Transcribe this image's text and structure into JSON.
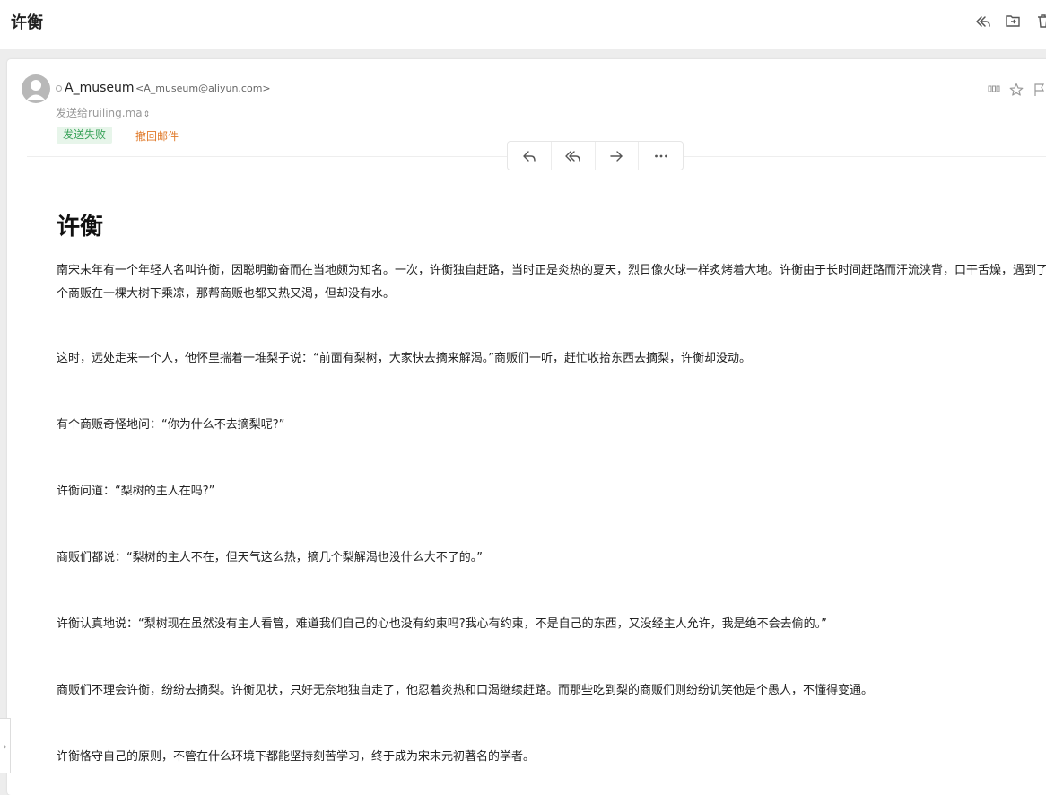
{
  "header": {
    "title": "许衡",
    "icons": [
      "reply-all-icon",
      "move-folder-icon",
      "delete-icon"
    ]
  },
  "message": {
    "sender_name": "A_museum",
    "sender_email": "<A_museum@aliyun.com>",
    "recipients": "发送给ruiling.ma",
    "status_badge": "发送失败",
    "recall_label": "撤回邮件",
    "header_icons": [
      "more-options-icon",
      "star-icon",
      "flag-icon"
    ],
    "actions": [
      "reply-icon",
      "reply-all-icon",
      "forward-icon",
      "more-icon"
    ]
  },
  "body": {
    "title": "许衡",
    "paragraphs": [
      "南宋末年有一个年轻人名叫许衡，因聪明勤奋而在当地颇为知名。一次，许衡独自赶路，当时正是炎热的夏天，烈日像火球一样炙烤着大地。许衡由于长时间赶路而汗流浃背，口干舌燥，遇到了几个商贩在一棵大树下乘凉，那帮商贩也都又热又渴，但却没有水。",
      "这时，远处走来一个人，他怀里揣着一堆梨子说：“前面有梨树，大家快去摘来解渴。”商贩们一听，赶忙收拾东西去摘梨，许衡却没动。",
      "有个商贩奇怪地问：“你为什么不去摘梨呢?”",
      "许衡问道：“梨树的主人在吗?”",
      "商贩们都说：“梨树的主人不在，但天气这么热，摘几个梨解渴也没什么大不了的。”",
      "许衡认真地说：“梨树现在虽然没有主人看管，难道我们自己的心也没有约束吗?我心有约束，不是自己的东西，又没经主人允许，我是绝不会去偷的。”",
      "商贩们不理会许衡，纷纷去摘梨。许衡见状，只好无奈地独自走了，他忍着炎热和口渴继续赶路。而那些吃到梨的商贩们则纷纷讥笑他是个愚人，不懂得变通。",
      "许衡恪守自己的原则，不管在什么环境下都能坚持刻苦学习，终于成为宋末元初著名的学者。"
    ]
  },
  "colors": {
    "badge_bg": "#e7f5ea",
    "badge_text": "#3aa35a",
    "recall_link": "#e07a2a"
  }
}
